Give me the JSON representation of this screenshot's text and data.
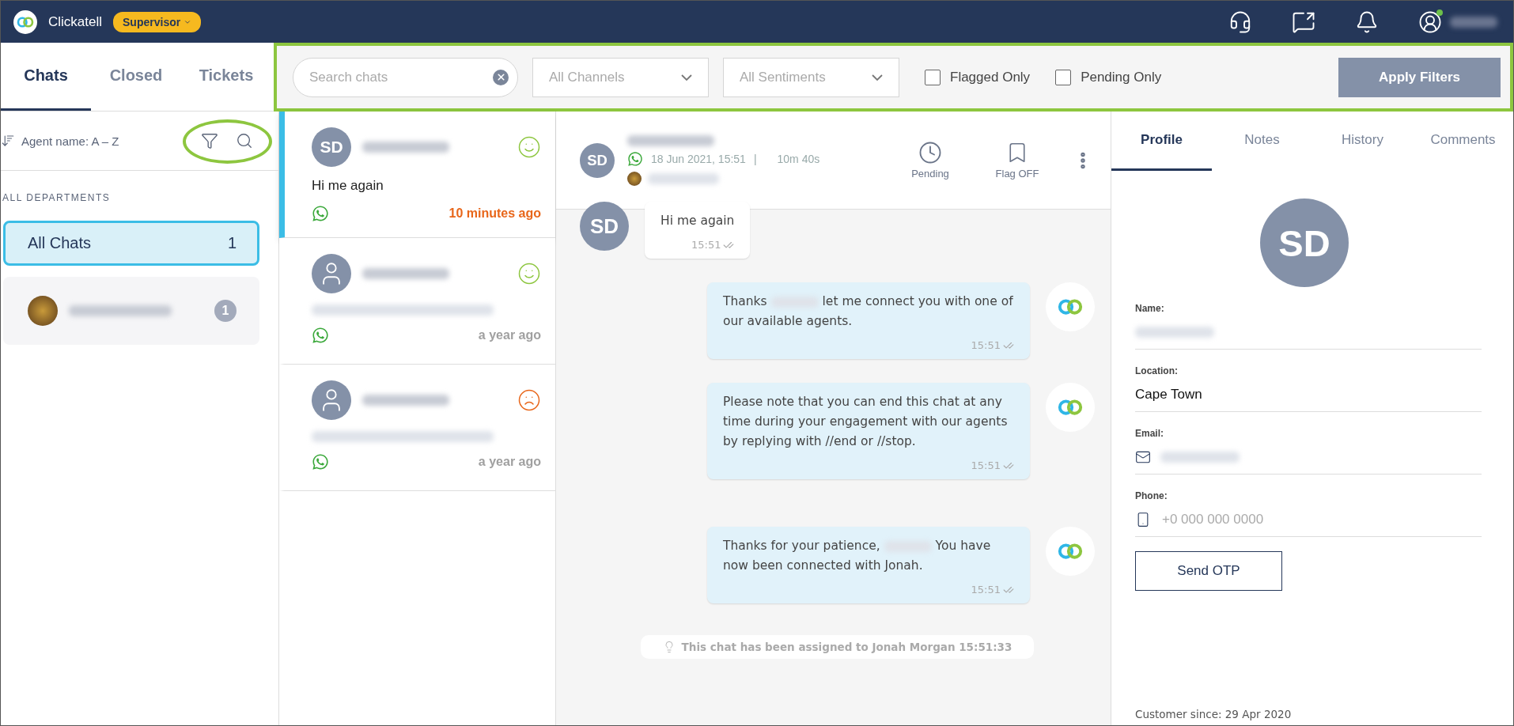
{
  "topbar": {
    "brand": "Clickatell",
    "role": "Supervisor",
    "user_online": true
  },
  "left_tabs": [
    {
      "label": "Chats",
      "selected": true
    },
    {
      "label": "Closed",
      "selected": false
    },
    {
      "label": "Tickets",
      "selected": false
    }
  ],
  "sort": {
    "label": "Agent name: A – Z"
  },
  "departments": {
    "heading": "ALL DEPARTMENTS",
    "items": [
      {
        "kind": "all",
        "label": "All Chats",
        "count": "1",
        "selected": true
      },
      {
        "kind": "agent",
        "count": "1",
        "selected": false
      }
    ]
  },
  "filters": {
    "search_placeholder": "Search chats",
    "dropdowns": [
      {
        "placeholder": "All Channels"
      },
      {
        "placeholder": "All Sentiments"
      }
    ],
    "checkboxes": [
      {
        "label": "Flagged Only",
        "checked": false
      },
      {
        "label": "Pending Only",
        "checked": false
      }
    ],
    "apply": "Apply Filters"
  },
  "chat_list": [
    {
      "avatar": {
        "kind": "initials",
        "text": "SD"
      },
      "sentiment": {
        "kind": "happy",
        "color": "#8dc63f"
      },
      "preview": "Hi me again",
      "time": "10 minutes ago",
      "time_highlight": true,
      "selected": true
    },
    {
      "avatar": {
        "kind": "person"
      },
      "sentiment": {
        "kind": "happy",
        "color": "#8dc63f"
      },
      "time": "a year ago",
      "time_highlight": false,
      "selected": false
    },
    {
      "avatar": {
        "kind": "person"
      },
      "sentiment": {
        "kind": "sad",
        "color": "#e8661a"
      },
      "time": "a year ago",
      "time_highlight": false,
      "selected": false
    }
  ],
  "chat_header": {
    "avatar": "SD",
    "date": "18 Jun 2021, 15:51",
    "separator": "|",
    "duration": "10m 40s",
    "actions": [
      {
        "kind": "pending",
        "label": "Pending"
      },
      {
        "kind": "flag",
        "label": "Flag OFF"
      }
    ]
  },
  "messages": [
    {
      "kind": "incoming",
      "avatar": "SD",
      "parts": [
        "Hi me again"
      ],
      "time": "15:51"
    },
    {
      "kind": "outgoing",
      "parts": [
        "Thanks",
        "let me connect you with one of our available agents."
      ],
      "time": "15:51"
    },
    {
      "kind": "outgoing",
      "parts": [
        "Please note that you can end this chat at any time during your engagement with our agents by replying with //end or //stop."
      ],
      "time": "15:51"
    },
    {
      "kind": "outgoing",
      "parts": [
        "Thanks for your patience,",
        "You have now been connected with Jonah."
      ],
      "time": "15:51"
    }
  ],
  "notice": "This chat has been assigned to Jonah Morgan 15:51:33",
  "profile": {
    "tabs": [
      {
        "label": "Profile",
        "selected": true
      },
      {
        "label": "Notes",
        "selected": false
      },
      {
        "label": "History",
        "selected": false
      },
      {
        "label": "Comments",
        "selected": false
      }
    ],
    "avatar": "SD",
    "fields": [
      {
        "label": "Name:",
        "kind": "redacted"
      },
      {
        "label": "Location:",
        "kind": "text",
        "value": "Cape Town"
      },
      {
        "label": "Email:",
        "kind": "email"
      },
      {
        "label": "Phone:",
        "kind": "phone",
        "placeholder": "+0 000 000 0000"
      }
    ],
    "button": "Send OTP",
    "customer_since": "Customer since: 29 Apr 2020"
  }
}
